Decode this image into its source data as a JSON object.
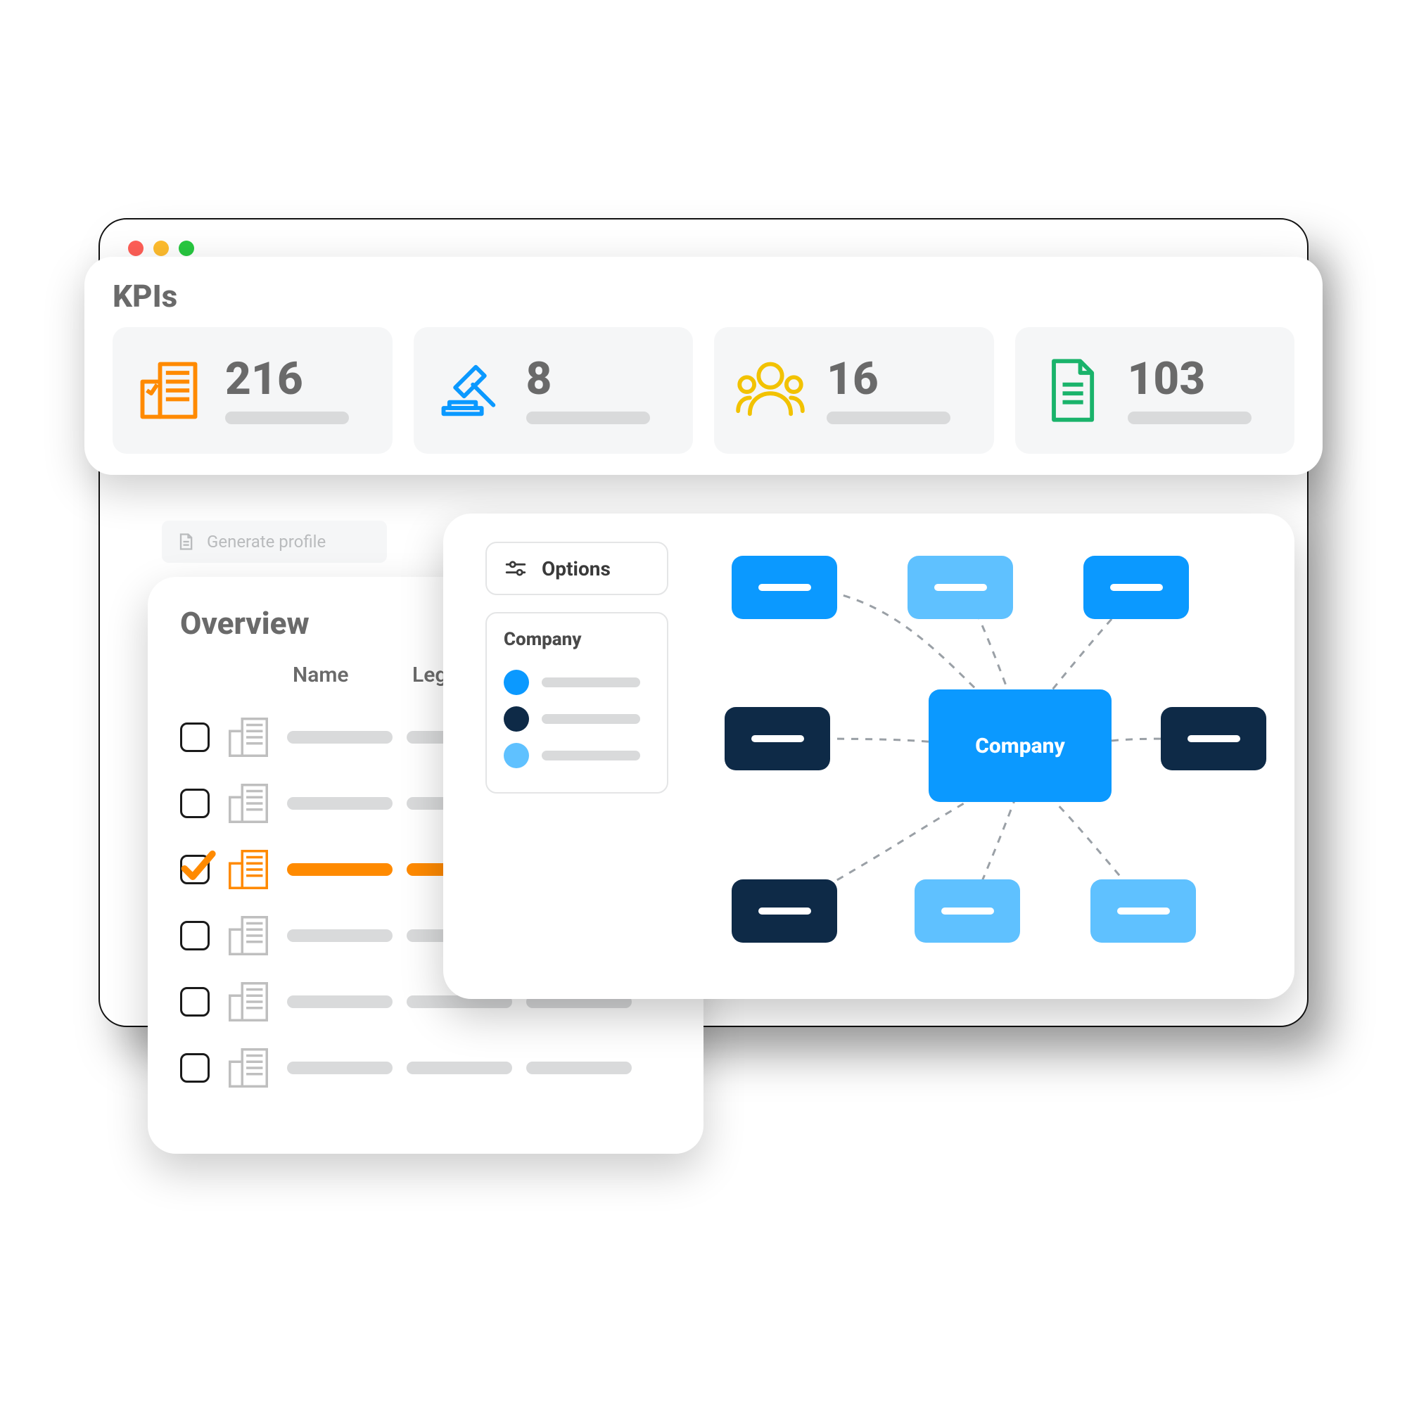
{
  "kpi": {
    "title": "KPIs",
    "tiles": [
      {
        "value": "216",
        "icon": "building-icon",
        "color": "#ff8a00"
      },
      {
        "value": "8",
        "icon": "gavel-icon",
        "color": "#0b99ff"
      },
      {
        "value": "16",
        "icon": "people-icon",
        "color": "#f2c200"
      },
      {
        "value": "103",
        "icon": "document-icon",
        "color": "#1ab36b"
      }
    ]
  },
  "generate_btn": "Generate profile",
  "overview": {
    "title": "Overview",
    "headers": {
      "name": "Name",
      "legal": "Legal form"
    },
    "rows": [
      {
        "selected": false
      },
      {
        "selected": false
      },
      {
        "selected": true
      },
      {
        "selected": false
      },
      {
        "selected": false
      },
      {
        "selected": false
      }
    ]
  },
  "diagram": {
    "options_label": "Options",
    "legend_title": "Company",
    "legend": [
      {
        "color": "#0b99ff"
      },
      {
        "color": "#0e2a47"
      },
      {
        "color": "#5fc1ff"
      }
    ],
    "center_label": "Company"
  }
}
